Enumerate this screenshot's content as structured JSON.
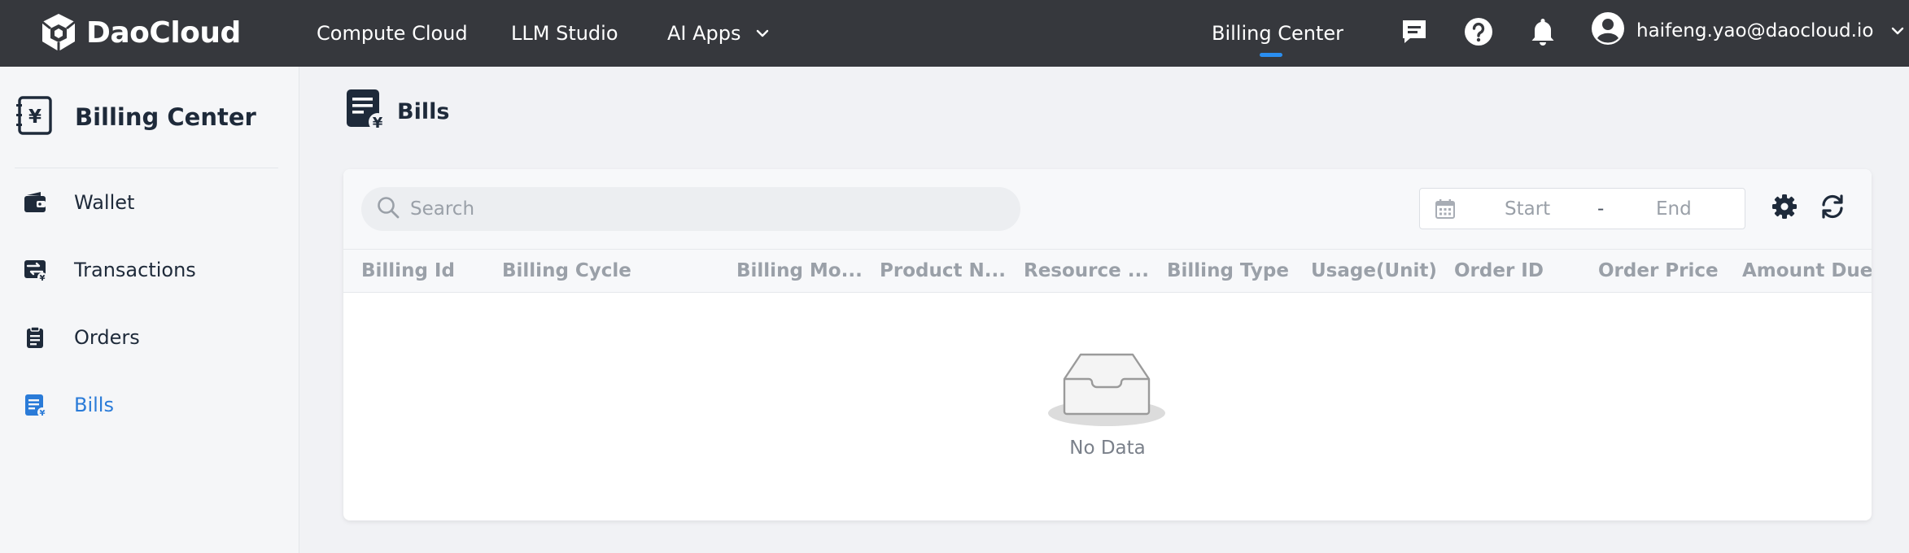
{
  "brand": {
    "name": "DaoCloud"
  },
  "topnav": {
    "items": [
      {
        "label": "Compute Cloud"
      },
      {
        "label": "LLM Studio"
      },
      {
        "label": "AI Apps"
      }
    ],
    "billing_center": "Billing Center",
    "user_email": "haifeng.yao@daocloud.io"
  },
  "icons": {
    "messages": "message-icon",
    "help": "help-icon",
    "notifications": "bell-icon",
    "avatar": "user-avatar-icon"
  },
  "sidebar": {
    "title": "Billing Center",
    "items": [
      {
        "label": "Wallet",
        "icon": "wallet-icon",
        "active": false
      },
      {
        "label": "Transactions",
        "icon": "transactions-icon",
        "active": false
      },
      {
        "label": "Orders",
        "icon": "orders-icon",
        "active": false
      },
      {
        "label": "Bills",
        "icon": "bills-icon",
        "active": true
      }
    ]
  },
  "page": {
    "title": "Bills",
    "search": {
      "placeholder": "Search",
      "value": ""
    },
    "date_range": {
      "start_placeholder": "Start",
      "separator": "-",
      "end_placeholder": "End"
    },
    "table": {
      "columns": [
        "Billing Id",
        "Billing Cycle",
        "Billing Mo...",
        "Product N...",
        "Resource ...",
        "Billing Type",
        "Usage(Unit)",
        "Order ID",
        "Order Price",
        "Amount Due"
      ],
      "rows": []
    },
    "empty_text": "No Data"
  },
  "colors": {
    "topbar": "#36383d",
    "accent": "#2a7bd8",
    "active_indicator": "#2a8ef0",
    "text": "#1e2a3a",
    "muted": "#9aa0a8"
  }
}
